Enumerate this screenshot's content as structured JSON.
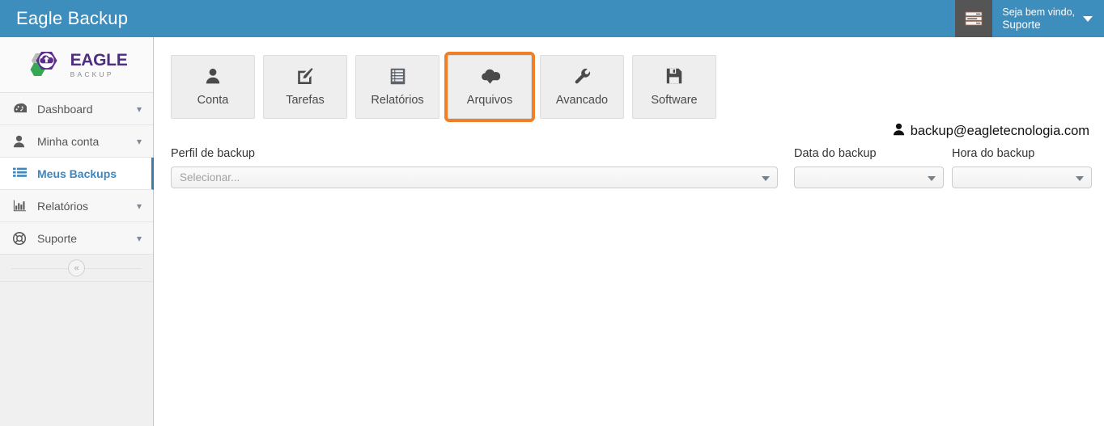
{
  "header": {
    "app_title": "Eagle Backup",
    "tasks_icon": "tasks-list-icon",
    "welcome_line1": "Seja bem vindo,",
    "welcome_line2": "Suporte",
    "caret_icon": "chevron-down-icon",
    "bg_color": "#3d8dbd",
    "tasks_bg_color": "#555555"
  },
  "sidebar": {
    "logo": {
      "name_primary": "EAGLE",
      "name_secondary": "BACKUP",
      "icon": "eagle-hexagon-cloud-logo",
      "purple": "#4f2d80",
      "green": "#34a853",
      "gray": "#b9b9b9"
    },
    "items": [
      {
        "label": "Dashboard",
        "icon": "dashboard-gauge-icon",
        "chevron": "chevron-down-icon",
        "active": false
      },
      {
        "label": "Minha conta",
        "icon": "user-icon",
        "chevron": "chevron-down-icon",
        "active": false
      },
      {
        "label": "Meus Backups",
        "icon": "list-icon",
        "chevron": "",
        "active": true
      },
      {
        "label": "Relatórios",
        "icon": "bar-chart-icon",
        "chevron": "chevron-down-icon",
        "active": false
      },
      {
        "label": "Suporte",
        "icon": "lifebuoy-icon",
        "chevron": "chevron-down-icon",
        "active": false
      }
    ],
    "collapse_label": "«",
    "collapse_icon": "collapse-sidebar-icon",
    "active_accent": "#3e86bd"
  },
  "main": {
    "nav_buttons": [
      {
        "label": "Conta",
        "icon": "user-icon",
        "selected": false
      },
      {
        "label": "Tarefas",
        "icon": "edit-pencil-icon",
        "selected": false
      },
      {
        "label": "Relatórios",
        "icon": "list-report-icon",
        "selected": false
      },
      {
        "label": "Arquivos",
        "icon": "cloud-download-icon",
        "selected": true
      },
      {
        "label": "Avancado",
        "icon": "wrench-icon",
        "selected": false
      },
      {
        "label": "Software",
        "icon": "floppy-save-icon",
        "selected": false
      }
    ],
    "selection_color": "#ef7f29",
    "account": {
      "icon": "user-icon",
      "email": "backup@eagletecnologia.com"
    },
    "form": {
      "profile": {
        "label": "Perfil de backup",
        "value": "",
        "placeholder": "Selecionar...",
        "caret": "chevron-down-icon"
      },
      "date": {
        "label": "Data do backup",
        "value": "",
        "placeholder": "",
        "caret": "chevron-down-icon"
      },
      "time": {
        "label": "Hora do backup",
        "value": "",
        "placeholder": "",
        "caret": "chevron-down-icon"
      }
    }
  }
}
